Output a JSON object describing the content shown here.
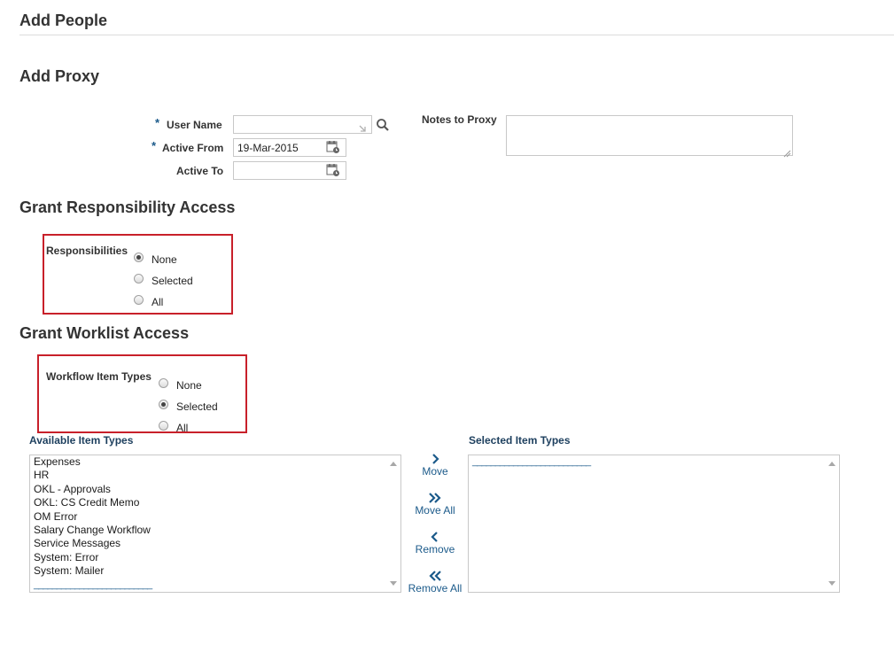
{
  "page": {
    "title": "Add People"
  },
  "proxy": {
    "section_title": "Add Proxy",
    "required_mark": "*",
    "user_name_label": "User Name",
    "user_name_value": "",
    "active_from_label": "Active From",
    "active_from_value": "19-Mar-2015",
    "active_to_label": "Active To",
    "active_to_value": "",
    "notes_label": "Notes to Proxy",
    "notes_value": ""
  },
  "responsibility": {
    "section_title": "Grant Responsibility Access",
    "field_label": "Responsibilities",
    "options": [
      "None",
      "Selected",
      "All"
    ],
    "selected": "None"
  },
  "worklist": {
    "section_title": "Grant Worklist Access",
    "field_label": "Workflow Item Types",
    "options": [
      "None",
      "Selected",
      "All"
    ],
    "selected": "Selected"
  },
  "shuttle": {
    "available_label": "Available Item Types",
    "selected_label": "Selected Item Types",
    "available_items": [
      "Expenses",
      "HR",
      "OKL - Approvals",
      "OKL: CS Credit Memo",
      "OM Error",
      "Salary Change Workflow",
      "Service Messages",
      "System: Error",
      "System: Mailer",
      "__________________________"
    ],
    "selected_items": [
      "__________________________"
    ],
    "buttons": {
      "move": "Move",
      "move_all": "Move All",
      "remove": "Remove",
      "remove_all": "Remove All"
    }
  },
  "colors": {
    "accent": "#1b5a8a",
    "highlight_box": "#c8202a"
  },
  "icons": {
    "search": "search-icon",
    "lov": "list-of-values-icon",
    "calendar": "calendar-icon"
  }
}
